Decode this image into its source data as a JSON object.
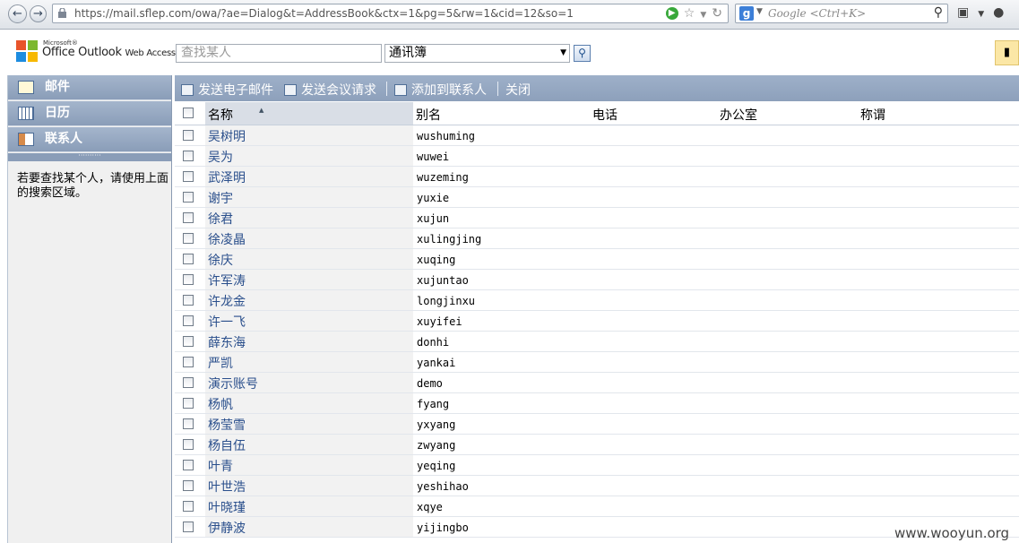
{
  "browser": {
    "url": "https://mail.sflep.com/owa/?ae=Dialog&t=AddressBook&ctx=1&pg=5&rw=1&cid=12&so=1",
    "search_placeholder": "Google <Ctrl+K>"
  },
  "header": {
    "brand_small": "Microsoft®",
    "brand_title": "Office Outlook",
    "brand_suffix": "Web Access",
    "find_placeholder": "查找某人",
    "addressbook_selected": "通讯簿"
  },
  "nav": {
    "items": [
      {
        "label": "邮件",
        "icon": "mail-icon"
      },
      {
        "label": "日历",
        "icon": "calendar-icon"
      },
      {
        "label": "联系人",
        "icon": "contacts-icon"
      }
    ],
    "hint": "若要查找某个人，请使用上面的搜索区域。"
  },
  "toolbar": {
    "send_email": "发送电子邮件",
    "send_meeting": "发送会议请求",
    "add_contact": "添加到联系人",
    "close": "关闭"
  },
  "grid": {
    "columns": [
      "名称",
      "别名",
      "电话",
      "办公室",
      "称谓"
    ],
    "rows": [
      {
        "name": "吴树明",
        "alias": "wushuming"
      },
      {
        "name": "吴为",
        "alias": "wuwei"
      },
      {
        "name": "武泽明",
        "alias": "wuzeming"
      },
      {
        "name": "谢宇",
        "alias": "yuxie"
      },
      {
        "name": "徐君",
        "alias": "xujun"
      },
      {
        "name": "徐凌晶",
        "alias": "xulingjing"
      },
      {
        "name": "徐庆",
        "alias": "xuqing"
      },
      {
        "name": "许军涛",
        "alias": "xujuntao"
      },
      {
        "name": "许龙金",
        "alias": "longjinxu"
      },
      {
        "name": "许一飞",
        "alias": "xuyifei"
      },
      {
        "name": "薛东海",
        "alias": "donhi"
      },
      {
        "name": "严凯",
        "alias": "yankai"
      },
      {
        "name": "演示账号",
        "alias": "demo"
      },
      {
        "name": "杨帆",
        "alias": "fyang"
      },
      {
        "name": "杨莹雪",
        "alias": "yxyang"
      },
      {
        "name": "杨自伍",
        "alias": "zwyang"
      },
      {
        "name": "叶青",
        "alias": "yeqing"
      },
      {
        "name": "叶世浩",
        "alias": "yeshihao"
      },
      {
        "name": "叶晓瑾",
        "alias": "xqye"
      },
      {
        "name": "伊静波",
        "alias": "yijingbo"
      }
    ]
  },
  "watermark": "www.wooyun.org"
}
